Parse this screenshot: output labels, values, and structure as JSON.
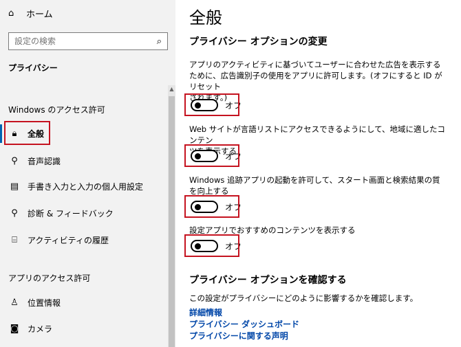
{
  "sidebar": {
    "home_label": "ホーム",
    "search_placeholder": "設定の検索",
    "section_title": "プライバシー",
    "group_windows": "Windows のアクセス許可",
    "windows_items": [
      {
        "label": "全般",
        "icon": "lock-icon"
      },
      {
        "label": "音声認識",
        "icon": "speech-icon"
      },
      {
        "label": "手書き入力と入力の個人用設定",
        "icon": "inking-typing-icon"
      },
      {
        "label": "診断 & フィードバック",
        "icon": "diagnostics-icon"
      },
      {
        "label": "アクティビティの履歴",
        "icon": "activity-history-icon"
      }
    ],
    "group_apps": "アプリのアクセス許可",
    "app_items": [
      {
        "label": "位置情報",
        "icon": "location-icon"
      },
      {
        "label": "カメラ",
        "icon": "camera-icon"
      }
    ]
  },
  "main": {
    "title": "全般",
    "options_heading": "プライバシー オプションの変更",
    "options": [
      {
        "line1": "アプリのアクティビティに基づいてユーザーに合わせた広告を表示するために、広告識別子の使用をアプリに許可します。(オフにすると ID がリセット",
        "line2": "されます。)",
        "state": "オフ"
      },
      {
        "line1": "Web サイトが言語リストにアクセスできるようにして、地域に適したコンテン",
        "line2": "ツを表示する",
        "state": "オフ"
      },
      {
        "line1": "Windows 追跡アプリの起動を許可して、スタート画面と検索結果の質",
        "line2": "を向上する",
        "state": "オフ"
      },
      {
        "line1": "設定アプリでおすすめのコンテンツを表示する",
        "line2": "",
        "state": "オフ"
      }
    ],
    "review_heading": "プライバシー オプションを確認する",
    "review_desc": "この設定がプライバシーにどのように影響するかを確認します。",
    "links": [
      "詳細情報",
      "プライバシー ダッシュボード",
      "プライバシーに関する声明"
    ]
  },
  "colors": {
    "accent": "#0063b1",
    "highlight_box": "#c5121f",
    "link": "#0046a8",
    "sidebar_bg": "#f2f2f2"
  }
}
